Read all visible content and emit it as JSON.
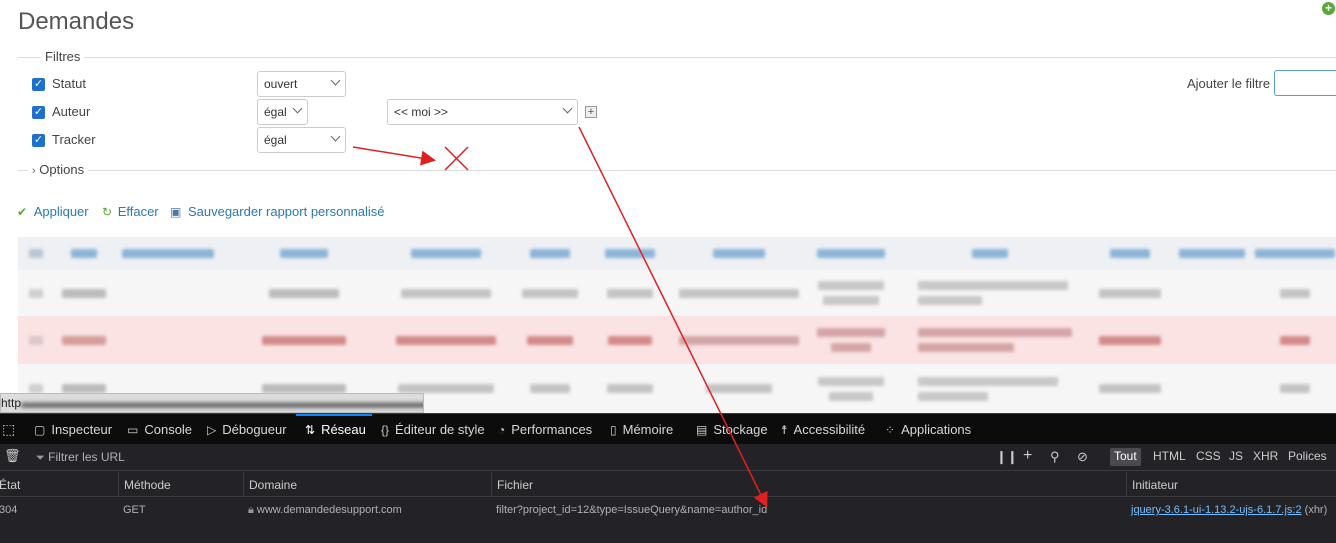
{
  "page": {
    "title": "Demandes"
  },
  "filters": {
    "legend": "Filtres",
    "rows": [
      {
        "label": "Statut",
        "operator": "ouvert"
      },
      {
        "label": "Auteur",
        "operator": "égal",
        "value": "<< moi >>"
      },
      {
        "label": "Tracker",
        "operator": "égal"
      }
    ],
    "add_filter_label": "Ajouter le filtre"
  },
  "options": {
    "legend": "Options"
  },
  "actions": {
    "apply": "Appliquer",
    "clear": "Effacer",
    "save": "Sauvegarder rapport personnalisé"
  },
  "url_bar": {
    "prefix": "http"
  },
  "devtools": {
    "tabs": [
      {
        "label": "Inspecteur",
        "icon": "inspector-icon"
      },
      {
        "label": "Console",
        "icon": "console-icon"
      },
      {
        "label": "Débogueur",
        "icon": "debugger-icon"
      },
      {
        "label": "Réseau",
        "icon": "network-icon",
        "active": true
      },
      {
        "label": "Éditeur de style",
        "icon": "style-editor-icon"
      },
      {
        "label": "Performances",
        "icon": "performance-icon"
      },
      {
        "label": "Mémoire",
        "icon": "memory-icon"
      },
      {
        "label": "Stockage",
        "icon": "storage-icon"
      },
      {
        "label": "Accessibilité",
        "icon": "accessibility-icon"
      },
      {
        "label": "Applications",
        "icon": "applications-icon"
      }
    ],
    "filter_placeholder": "Filtrer les URL",
    "type_filters": [
      "Tout",
      "HTML",
      "CSS",
      "JS",
      "XHR",
      "Polices"
    ],
    "columns": [
      "État",
      "Méthode",
      "Domaine",
      "Fichier",
      "Initiateur"
    ],
    "request": {
      "status": "304",
      "method": "GET",
      "domain": "www.demandedesupport.com",
      "file": "filter?project_id=12&type=IssueQuery&name=author_id",
      "initiator": "jquery-3.6.1-ui-1.13.2-ujs-6.1.7.js:2",
      "initiator_type": "(xhr)"
    }
  },
  "colors": {
    "link": "#2a7ab0",
    "checkbox": "#1f6fd1",
    "annotation": "#e02020",
    "devtools_bg": "#232327",
    "devtools_accent": "#0a84ff"
  }
}
